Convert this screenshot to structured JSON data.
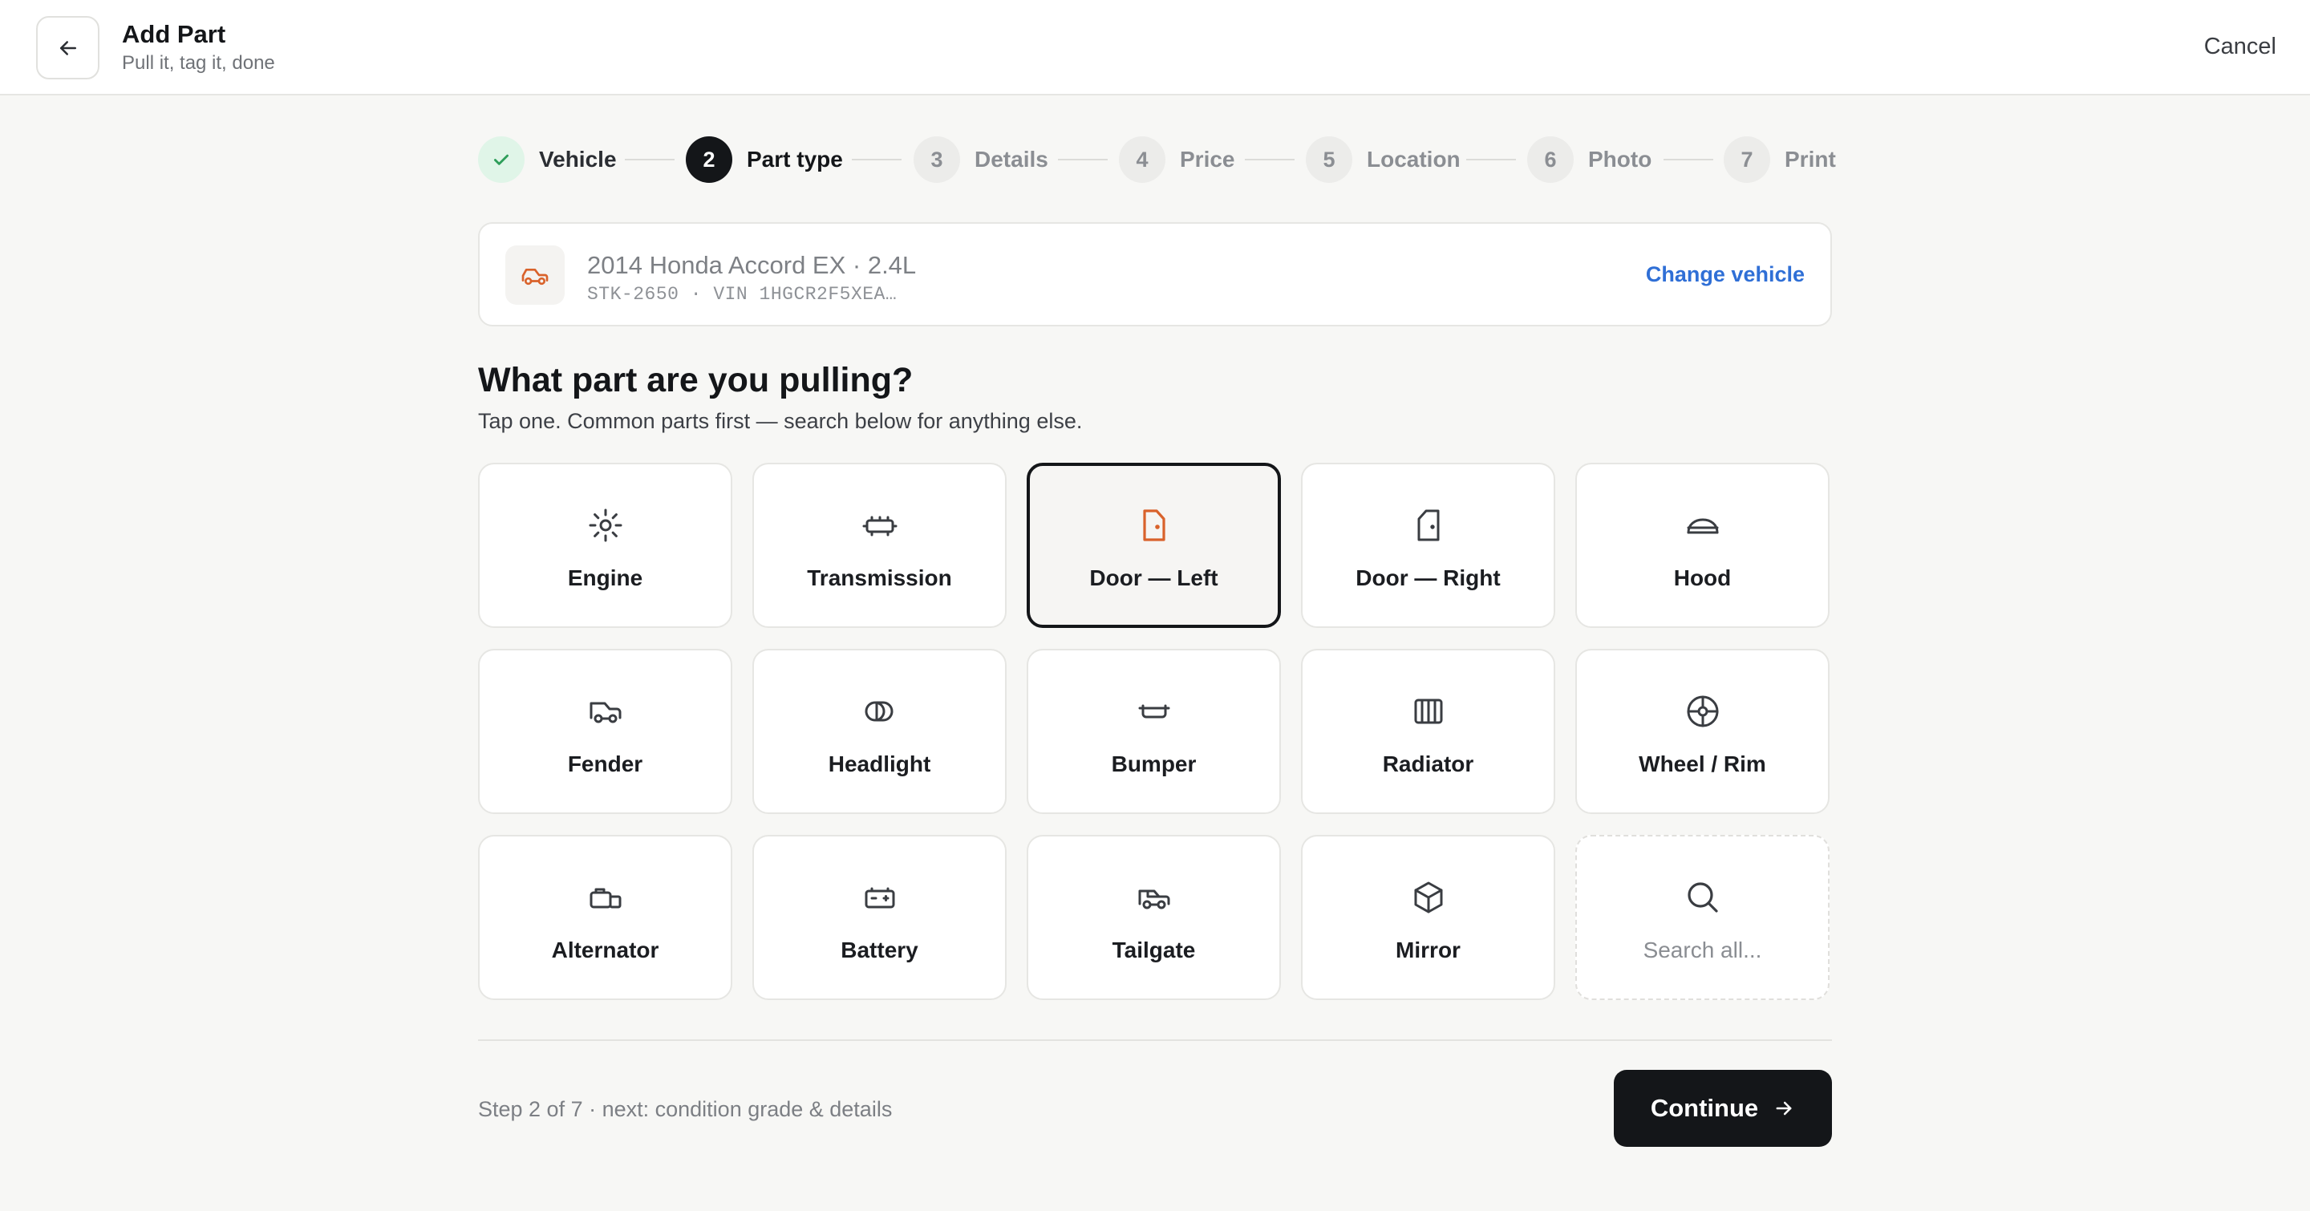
{
  "header": {
    "title": "Add Part",
    "subtitle": "Pull it, tag it, done",
    "back_icon": "arrow-left-icon",
    "cancel_label": "Cancel"
  },
  "stepper": {
    "current_step": 2,
    "total_steps": 7,
    "steps": [
      {
        "label": "Vehicle",
        "number": "1",
        "status": "done"
      },
      {
        "label": "Part type",
        "number": "2",
        "status": "active"
      },
      {
        "label": "Details",
        "number": "3",
        "status": "todo"
      },
      {
        "label": "Price",
        "number": "4",
        "status": "todo"
      },
      {
        "label": "Location",
        "number": "5",
        "status": "todo"
      },
      {
        "label": "Photo",
        "number": "6",
        "status": "todo"
      },
      {
        "label": "Print",
        "number": "7",
        "status": "todo"
      }
    ]
  },
  "vehicle": {
    "name": "2014 Honda Accord EX · 2.4L",
    "meta": "STK-2650 · VIN 1HGCR2F5XEA…",
    "icon": "car-icon",
    "change_label": "Change vehicle"
  },
  "prompt": {
    "question": "What part are you pulling?",
    "hint": "Tap one. Common parts first — search below for anything else."
  },
  "parts": [
    {
      "label": "Engine",
      "icon": "engine-icon",
      "selected": false
    },
    {
      "label": "Transmission",
      "icon": "transmission-icon",
      "selected": false
    },
    {
      "label": "Door — Left",
      "icon": "door-left-icon",
      "selected": true
    },
    {
      "label": "Door — Right",
      "icon": "door-right-icon",
      "selected": false
    },
    {
      "label": "Hood",
      "icon": "hood-icon",
      "selected": false
    },
    {
      "label": "Fender",
      "icon": "fender-icon",
      "selected": false
    },
    {
      "label": "Headlight",
      "icon": "headlight-icon",
      "selected": false
    },
    {
      "label": "Bumper",
      "icon": "bumper-icon",
      "selected": false
    },
    {
      "label": "Radiator",
      "icon": "radiator-icon",
      "selected": false
    },
    {
      "label": "Wheel / Rim",
      "icon": "wheel-icon",
      "selected": false
    },
    {
      "label": "Alternator",
      "icon": "alternator-icon",
      "selected": false
    },
    {
      "label": "Battery",
      "icon": "battery-icon",
      "selected": false
    },
    {
      "label": "Tailgate",
      "icon": "tailgate-icon",
      "selected": false
    },
    {
      "label": "Mirror",
      "icon": "mirror-icon",
      "selected": false
    },
    {
      "label": "Search all...",
      "icon": "search-icon",
      "selected": false
    }
  ],
  "footer": {
    "note": "Step 2 of 7 · next: condition grade & details",
    "continue_label": "Continue",
    "continue_icon": "arrow-right-icon"
  },
  "colors": {
    "background": "#f7f7f5",
    "accent_orange": "#d9622b",
    "link_blue": "#2f6fd6",
    "primary_dark": "#141619",
    "done_green_bg": "#e0f5e8",
    "done_green": "#2e9e5a"
  }
}
